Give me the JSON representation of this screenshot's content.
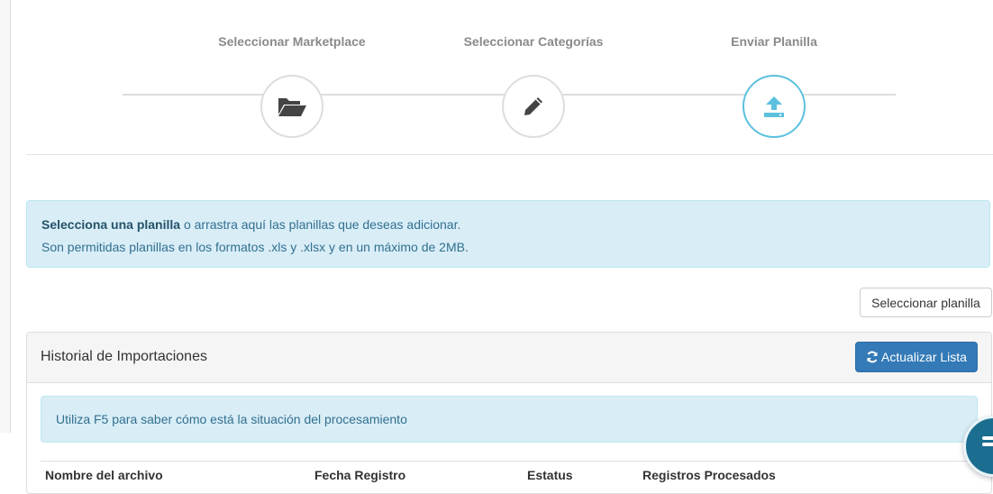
{
  "steps": [
    {
      "label": "Seleccionar Marketplace",
      "icon": "folder-open-icon",
      "active": false
    },
    {
      "label": "Seleccionar Categorías",
      "icon": "pencil-icon",
      "active": false
    },
    {
      "label": "Enviar Planilla",
      "icon": "upload-icon",
      "active": true
    }
  ],
  "dropzone": {
    "bold": "Selecciona una planilla",
    "line1_rest": " o arrastra aquí las planillas que deseas adicionar.",
    "line2": "Son permitidas planillas en los formatos .xls y .xlsx y en un máximo de 2MB."
  },
  "select_button": "Seleccionar planilla",
  "history": {
    "title": "Historial de Importaciones",
    "refresh_label": "Actualizar Lista",
    "info": "Utiliza F5 para saber cómo está la situación del procesamiento",
    "columns": [
      "Nombre del archivo",
      "Fecha Registro",
      "Estatus",
      "Registros Procesados"
    ]
  },
  "colors": {
    "accent": "#5bc0de",
    "primary": "#337ab7",
    "info_bg": "#d9edf7",
    "info_text": "#31708f",
    "chat": "#1b6e8f"
  }
}
